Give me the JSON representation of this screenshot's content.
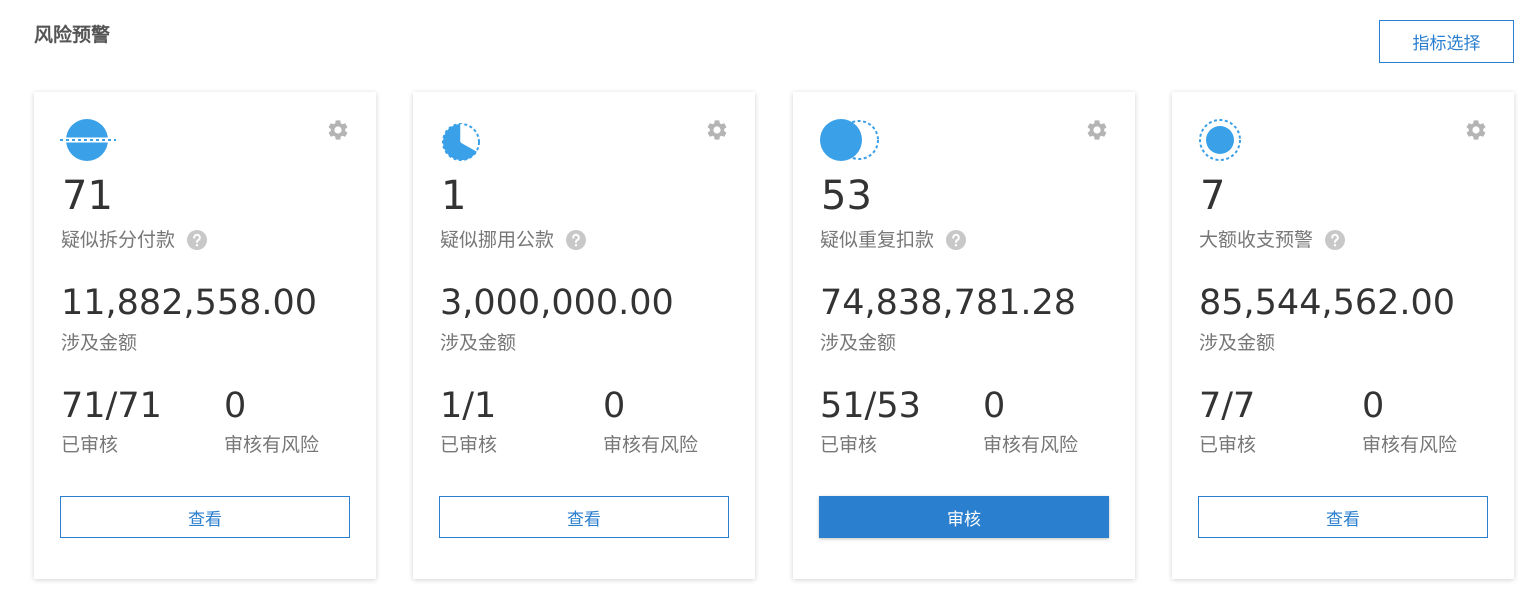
{
  "header": {
    "title": "风险预警",
    "indicator_button": "指标选择"
  },
  "colors": {
    "accent": "#2b7fcf",
    "icon_blue": "#3aa0e8",
    "gear_gray": "#b4b4b4"
  },
  "cards": [
    {
      "icon": "split-circle-icon",
      "count": "71",
      "name": "疑似拆分付款",
      "amount": "11,882,558.00",
      "amount_label": "涉及金额",
      "reviewed": "71/71",
      "reviewed_label": "已审核",
      "risk": "0",
      "risk_label": "审核有风险",
      "action": "查看"
    },
    {
      "icon": "pie-slice-icon",
      "count": "1",
      "name": "疑似挪用公款",
      "amount": "3,000,000.00",
      "amount_label": "涉及金额",
      "reviewed": "1/1",
      "reviewed_label": "已审核",
      "risk": "0",
      "risk_label": "审核有风险",
      "action": "查看"
    },
    {
      "icon": "duplicate-circle-icon",
      "count": "53",
      "name": "疑似重复扣款",
      "amount": "74,838,781.28",
      "amount_label": "涉及金额",
      "reviewed": "51/53",
      "reviewed_label": "已审核",
      "risk": "0",
      "risk_label": "审核有风险",
      "action": "审核"
    },
    {
      "icon": "target-circle-icon",
      "count": "7",
      "name": "大额收支预警",
      "amount": "85,544,562.00",
      "amount_label": "涉及金额",
      "reviewed": "7/7",
      "reviewed_label": "已审核",
      "risk": "0",
      "risk_label": "审核有风险",
      "action": "查看"
    }
  ]
}
